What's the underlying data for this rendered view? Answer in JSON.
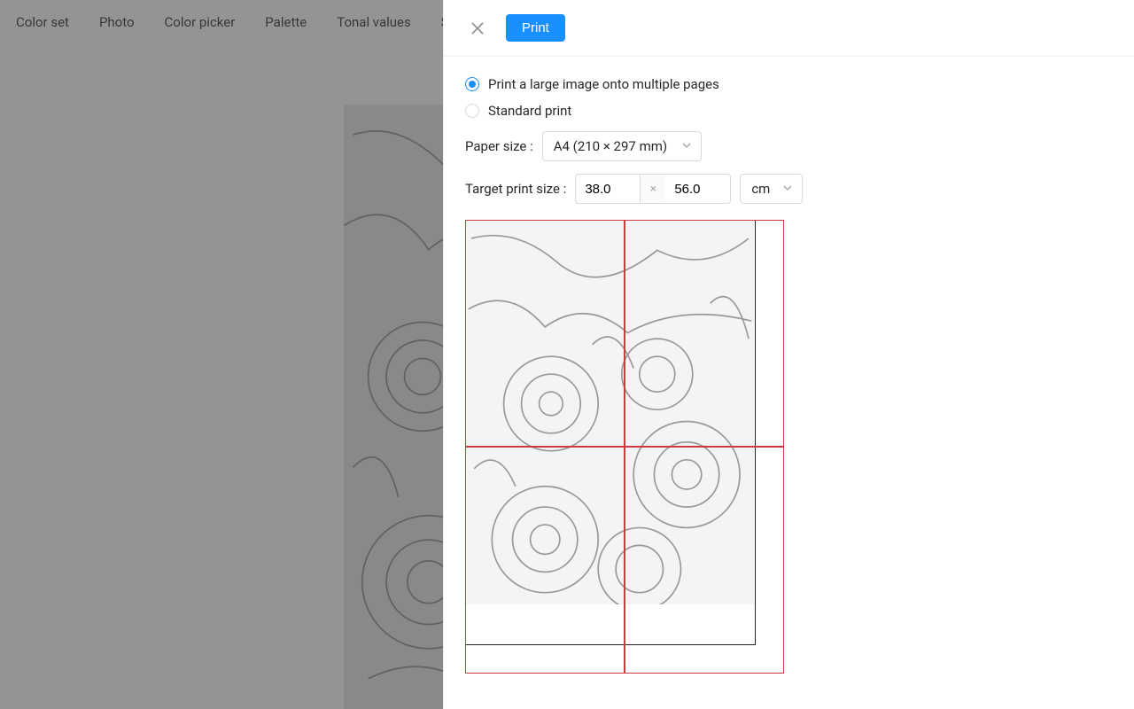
{
  "tabs": {
    "color_set": "Color set",
    "photo": "Photo",
    "color_picker": "Color picker",
    "palette": "Palette",
    "tonal_values": "Tonal values",
    "partial_tab": "S"
  },
  "modal": {
    "print_button": "Print",
    "option_multi": "Print a large image onto multiple pages",
    "option_standard": "Standard print",
    "paper_size_label": "Paper size :",
    "paper_size_value": "A4 (210 × 297 mm)",
    "target_print_size_label": "Target print size :",
    "width_value": "38.0",
    "height_value": "56.0",
    "times": "×",
    "unit_value": "cm"
  }
}
